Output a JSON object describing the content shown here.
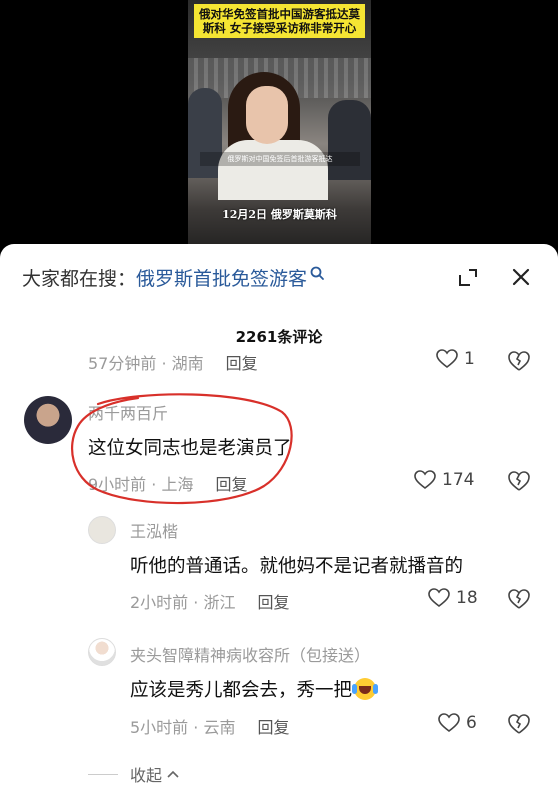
{
  "video": {
    "title": "俄对华免签首批中国游客抵达莫斯科 女子接受采访称非常开心",
    "subtitle": "俄罗斯对中国免签后首批游客抵达",
    "date_location": "12月2日 俄罗斯莫斯科"
  },
  "search": {
    "prefix": "大家都在搜：",
    "term": "俄罗斯首批免签游客"
  },
  "comments_count": "2261条评论",
  "prev_comment": {
    "time_loc": "57分钟前 · 湖南",
    "reply": "回复",
    "likes": "1"
  },
  "comments": [
    {
      "username": "两千两百斤",
      "text": "这位女同志也是老演员了",
      "time_loc": "9小时前 · 上海",
      "reply": "回复",
      "likes": "174"
    }
  ],
  "replies": [
    {
      "username": "王泓楷",
      "text": "听他的普通话。就他妈不是记者就播音的",
      "time_loc": "2小时前 · 浙江",
      "reply": "回复",
      "likes": "18"
    },
    {
      "username": "夹头智障精神病收容所（包接送）",
      "text": "应该是秀儿都会去，秀一把",
      "time_loc": "5小时前 · 云南",
      "reply": "回复",
      "likes": "6"
    }
  ],
  "collapse_label": "收起",
  "colors": {
    "search_term": "#2a5a9a",
    "annotation_circle": "#d8302a",
    "title_banner": "#f5e533"
  }
}
